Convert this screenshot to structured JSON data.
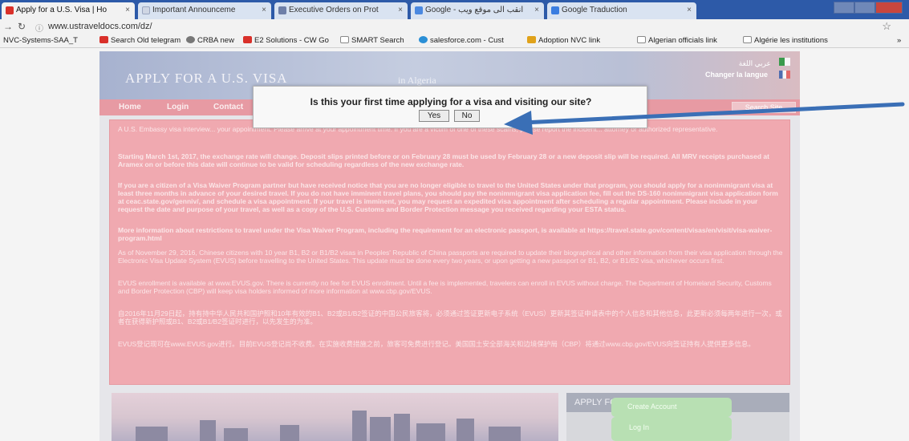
{
  "browser": {
    "tabs": [
      {
        "label": "Apply for a U.S. Visa | Ho",
        "active": true,
        "fav_color": "#d9302a"
      },
      {
        "label": "Important Announceme",
        "active": false,
        "fav_color": "#cfd6e4"
      },
      {
        "label": "Executive Orders on Prot",
        "active": false,
        "fav_color": "#6e7fa8"
      },
      {
        "label": "Google - انقب الى موقع ويب",
        "active": false,
        "fav_color": "#4a88e0"
      },
      {
        "label": "Google Traduction",
        "active": false,
        "fav_color": "#3b7de0"
      }
    ],
    "tab_close": "×",
    "url": "www.ustraveldocs.com/dz/",
    "bookmarks": [
      {
        "label": "NVC-Systems-SAA_T",
        "color": ""
      },
      {
        "label": "Search Old telegram",
        "color": "#d9302a"
      },
      {
        "label": "CRBA new",
        "color": "#777777"
      },
      {
        "label": "E2 Solutions - CW Go",
        "color": "#d9302a"
      },
      {
        "label": "SMART Search",
        "color": ""
      },
      {
        "label": "salesforce.com - Cust",
        "color": "#2a8fd6"
      },
      {
        "label": "Adoption NVC link",
        "color": "#e0a21a"
      },
      {
        "label": "Algerian officials link",
        "color": ""
      },
      {
        "label": "Algérie les institutions",
        "color": ""
      }
    ],
    "more_bookmarks": "»"
  },
  "site": {
    "title": "APPLY FOR A U.S. VISA",
    "subtitle": "in Algeria",
    "lang_arabic": "عربي اللغة",
    "lang_change": "Changer la langue",
    "nav": [
      "Home",
      "Login",
      "Contact"
    ],
    "search_button": "Search Site",
    "notices": [
      {
        "text": "A U.S. Embassy visa interview... your appointment. Please arrive at your appointment time. If you are a victim of one of these scams, please report the incident... attorney or authorized representative.",
        "bold": false
      },
      {
        "text": "Starting March 1st, 2017, the exchange rate will change. Deposit slips printed before or on February 28 must be used by February 28 or a new deposit slip will be required. All MRV receipts purchased at Aramex on or before this date will continue to be valid for scheduling regardless of the new exchange rate.",
        "bold": true
      },
      {
        "text": "If you are a citizen of a Visa Waiver Program partner but have received notice that you are no longer eligible to travel to the United States under that program, you should apply for a nonimmigrant visa at least three months in advance of your desired travel. If you do not have imminent travel plans, you should pay the nonimmigrant visa application fee, fill out the DS-160 nonimmigrant visa application form at ceac.state.gov/genniv/, and schedule a visa appointment. If your travel is imminent, you may request an expedited visa appointment after scheduling a regular appointment. Please include in your request the date and purpose of your travel, as well as a copy of the U.S. Customs and Border Protection message you received regarding your ESTA status.",
        "bold": true
      },
      {
        "text": "More information about restrictions to travel under the Visa Waiver Program, including the requirement for an electronic passport, is available at https://travel.state.gov/content/visas/en/visit/visa-waiver-program.html",
        "bold": true
      },
      {
        "text": "As of November 29, 2016, Chinese citizens with 10 year B1, B2 or B1/B2 visas in Peoples' Republic of China passports are required to update their biographical and other information from their visa application through the Electronic Visa Update System (EVUS) before travelling to the United States. This update must be done every two years, or upon getting a new passport or B1, B2, or B1/B2 visa, whichever occurs first.",
        "bold": false
      },
      {
        "text": "EVUS enrollment is available at www.EVUS.gov. There is currently no fee for EVUS enrollment. Until a fee is implemented, travelers can enroll in EVUS without charge. The Department of Homeland Security, Customs and Border Protection (CBP) will keep visa holders informed of more information at www.cbp.gov/EVUS.",
        "bold": false
      },
      {
        "text": "自2016年11月29日起，持有持中华人民共和国护照和10年有效的B1、B2或B1/B2签证的中国公民旅客将，必须通过签证更新电子系统（EVUS）更新其签证申请表中的个人信息和其他信息，此更新必须每两年进行一次，或者在获得新护照或B1、B2或B1/B2签证时进行，以先发生的为准。",
        "bold": false
      },
      {
        "text": "EVUS登记现可在www.EVUS.gov进行。目前EVUS登记尚不收费。在实施收费措施之前，旅客可免费进行登记。美国国土安全部海关和边境保护局（CBP）将通过www.cbp.gov/EVUS向签证持有人提供更多信息。",
        "bold": false
      }
    ],
    "panel_title": "APPLY FOR A U.S. VISA",
    "login_button": "Log In",
    "create_account_button": "Create Account"
  },
  "modal": {
    "question": "Is this your first time applying for a visa and visiting our site?",
    "yes_label": "Yes",
    "no_label": "No"
  },
  "annotation": {
    "arrow_color": "#3a6fb6"
  }
}
